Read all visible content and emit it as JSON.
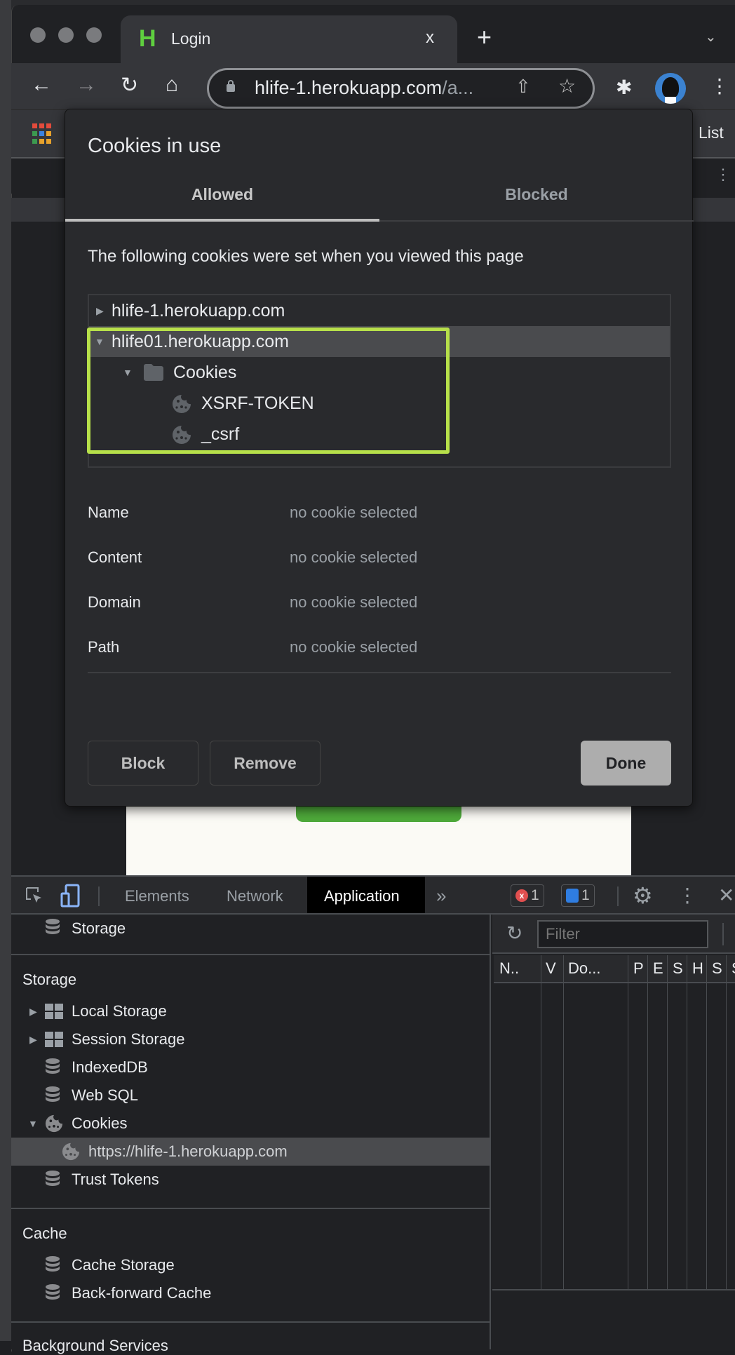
{
  "browser": {
    "tab": {
      "favicon_letter": "H",
      "title": "Login",
      "close": "x"
    },
    "new_tab": "+",
    "tab_list_chevron": "⌄",
    "url_host": "hlife-1.herokuapp.com",
    "url_rest": "/a...",
    "bookmarks_right_label": "List"
  },
  "dialog": {
    "title": "Cookies in use",
    "tabs": [
      {
        "label": "Allowed",
        "active": true
      },
      {
        "label": "Blocked",
        "active": false
      }
    ],
    "description": "The following cookies were set when you viewed this page",
    "tree": [
      {
        "label": "hlife-1.herokuapp.com",
        "expanded": false,
        "level": 0
      },
      {
        "label": "hlife01.herokuapp.com",
        "expanded": true,
        "level": 0,
        "selected": true
      },
      {
        "label": "Cookies",
        "expanded": true,
        "level": 1,
        "type": "folder"
      },
      {
        "label": "XSRF-TOKEN",
        "level": 2,
        "type": "cookie"
      },
      {
        "label": "_csrf",
        "level": 2,
        "type": "cookie"
      }
    ],
    "details": [
      {
        "label": "Name",
        "value": "no cookie selected"
      },
      {
        "label": "Content",
        "value": "no cookie selected"
      },
      {
        "label": "Domain",
        "value": "no cookie selected"
      },
      {
        "label": "Path",
        "value": "no cookie selected"
      }
    ],
    "buttons": {
      "block": "Block",
      "remove": "Remove",
      "done": "Done"
    },
    "highlight_color": "#b7e04a"
  },
  "devtools": {
    "tabs": [
      "Elements",
      "Network",
      "Application"
    ],
    "active_tab": "Application",
    "more": "»",
    "error_count": "1",
    "message_count": "1",
    "sidebar": {
      "top_item": "Storage",
      "storage_header": "Storage",
      "storage_items": [
        {
          "label": "Local Storage",
          "icon": "grid-icon",
          "expandable": true
        },
        {
          "label": "Session Storage",
          "icon": "grid-icon",
          "expandable": true
        },
        {
          "label": "IndexedDB",
          "icon": "database-icon"
        },
        {
          "label": "Web SQL",
          "icon": "database-icon"
        },
        {
          "label": "Cookies",
          "icon": "cookie-icon",
          "expanded": true
        },
        {
          "label": "https://hlife-1.herokuapp.com",
          "icon": "cookie-icon",
          "child": true,
          "selected": true
        },
        {
          "label": "Trust Tokens",
          "icon": "database-icon"
        }
      ],
      "cache_header": "Cache",
      "cache_items": [
        {
          "label": "Cache Storage",
          "icon": "database-icon"
        },
        {
          "label": "Back-forward Cache",
          "icon": "database-icon"
        }
      ],
      "next_header": "Background Services"
    },
    "filter_placeholder": "Filter",
    "columns": [
      "N..",
      "V",
      "Do...",
      "P",
      "E",
      "S",
      "H",
      "S",
      "S"
    ]
  }
}
